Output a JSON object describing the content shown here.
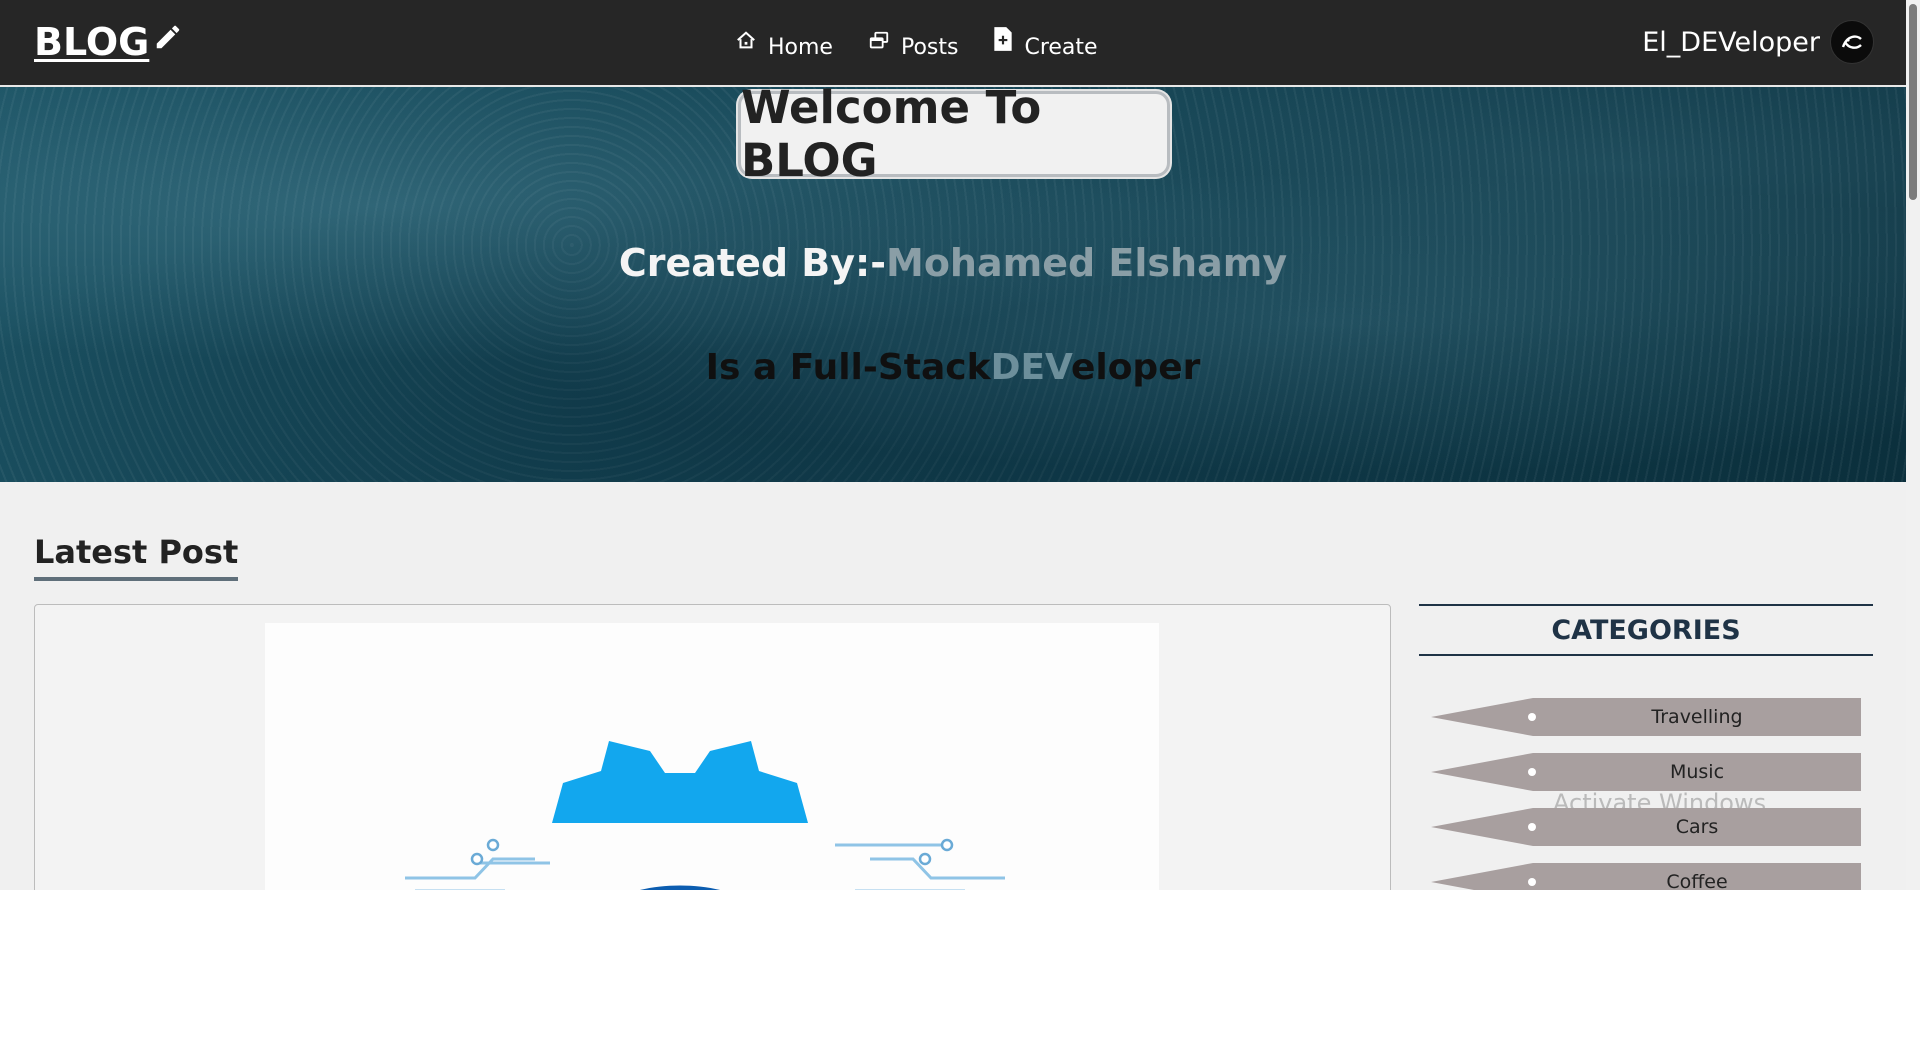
{
  "navbar": {
    "brand": "BLOG",
    "links": [
      {
        "label": "Home",
        "icon": "home-icon"
      },
      {
        "label": "Posts",
        "icon": "posts-icon"
      },
      {
        "label": "Create",
        "icon": "create-file-icon"
      }
    ],
    "username": "El_DEVeloper"
  },
  "hero": {
    "title": "Welcome To BLOG",
    "created_prefix": "Created By:-",
    "author": "Mohamed Elshamy",
    "tagline_prefix": "Is a Full-Stack",
    "tagline_highlight": "DEV",
    "tagline_suffix": "eloper"
  },
  "latest": {
    "heading": "Latest Post"
  },
  "categories": {
    "title": "CATEGORIES",
    "items": [
      "Travelling",
      "Music",
      "Cars",
      "Coffee"
    ]
  },
  "watermark": "Activate Windows",
  "colors": {
    "navbar": "#262626",
    "category_bar": "#a89f9f",
    "category_title": "#1f3346",
    "author": "#8a9ea6"
  }
}
